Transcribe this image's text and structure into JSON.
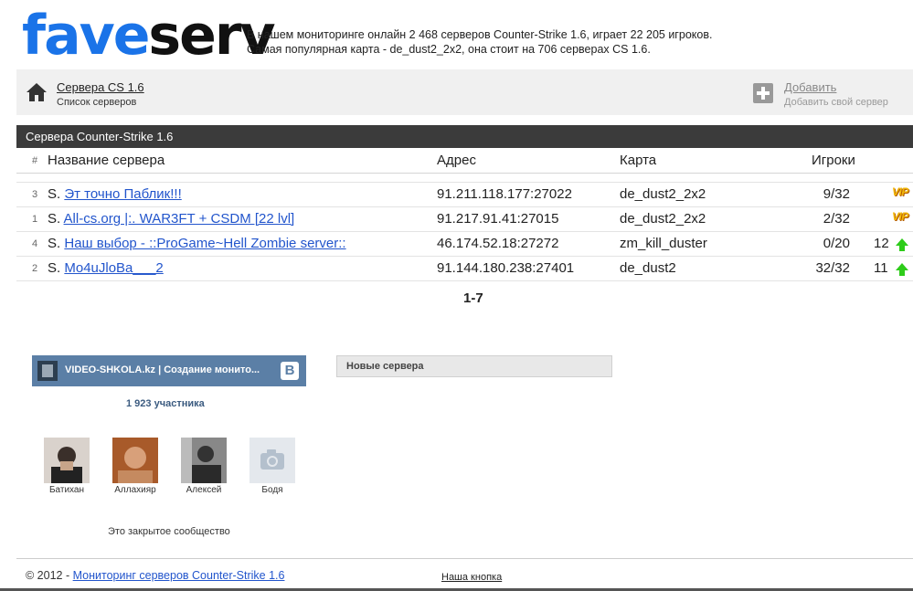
{
  "header": {
    "logo_part1": "fave",
    "logo_part2": "serv",
    "stats_line1": "В нашем мониторинге онлайн 2 468 серверов Counter-Strike 1.6, играет 22 205 игроков.",
    "stats_line2": "Самая популярная карта - de_dust2_2x2, она стоит на 706 серверах CS 1.6."
  },
  "breadcrumb": {
    "title": "Сервера CS 1.6",
    "subtitle": "Список серверов",
    "add_label": "Добавить",
    "add_subtitle": "Добавить свой сервер"
  },
  "section_title": "Сервера Counter-Strike 1.6",
  "table": {
    "headers": {
      "num": "#",
      "name": "Название сервера",
      "address": "Адрес",
      "map": "Карта",
      "players": "Игроки"
    },
    "rows": [
      {
        "num": "3",
        "prefix": "S.",
        "name": "Эт точно Паблик!!!",
        "address": "91.211.118.177:27022",
        "map": "de_dust2_2x2",
        "players": "9/32",
        "badge": "VIP",
        "extra": ""
      },
      {
        "num": "1",
        "prefix": "S.",
        "name": "All-cs.org |:. WAR3FT + CSDM [22 lvl]",
        "address": "91.217.91.41:27015",
        "map": "de_dust2_2x2",
        "players": "2/32",
        "badge": "VIP",
        "extra": ""
      },
      {
        "num": "4",
        "prefix": "S.",
        "name": "Наш выбор - ::ProGame~Hell Zombie server::",
        "address": "46.174.52.18:27272",
        "map": "zm_kill_duster",
        "players": "0/20",
        "badge": "",
        "extra": "12"
      },
      {
        "num": "2",
        "prefix": "S.",
        "name": "Mo4uJloBa___2",
        "address": "91.144.180.238:27401",
        "map": "de_dust2",
        "players": "32/32",
        "badge": "",
        "extra": "11"
      }
    ]
  },
  "pagination": "1-7",
  "vk_widget": {
    "group_name": "VIDEO-SHKOLA.kz | Создание монито...",
    "logo_letter": "В",
    "members": "1 923 участника",
    "people": [
      "Батихан",
      "Аллахияр",
      "Алексей",
      "Бодя"
    ],
    "closed_note": "Это закрытое сообщество"
  },
  "new_servers_title": "Новые сервера",
  "footer": {
    "copyright": "© 2012 - ",
    "copyright_link": "Мониторинг серверов Counter-Strike 1.6",
    "our_button": "Наша кнопка"
  },
  "colors": {
    "logo_blue": "#1a73e8",
    "section_bg": "#3b3b3b",
    "vk_blue": "#5b7fa6",
    "vip_gold": "#f2b705",
    "arrow_green": "#2ecc1a"
  },
  "icons": {
    "home": "home-icon",
    "add": "plus-icon",
    "vip": "vip-badge",
    "rank_up": "arrow-up-icon",
    "vk": "vk-logo-icon",
    "camera": "camera-icon"
  }
}
